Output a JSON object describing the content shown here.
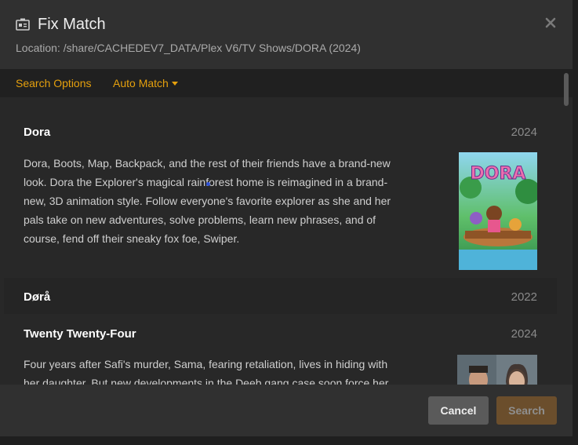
{
  "dialog": {
    "title": "Fix Match",
    "location": "Location: /share/CACHEDEV7_DATA/Plex V6/TV Shows/DORA (2024)",
    "icon": "id-card-icon",
    "close_icon": "close-icon"
  },
  "tabs": {
    "search_options": "Search Options",
    "auto_match": "Auto Match"
  },
  "results": [
    {
      "name": "Dora",
      "year": "2024",
      "summary": "Dora, Boots, Map, Backpack, and the rest of their friends have a brand-new look. Dora the Explorer's magical rainforest home is reimagined in a brand-new, 3D animation style. Follow everyone's favorite explorer as she and her pals take on new adventures, solve problems, learn new phrases, and of course, fend off their sneaky fox foe, Swiper.",
      "poster_text": "DORA"
    },
    {
      "name": "Dørå",
      "year": "2022"
    },
    {
      "name": "Twenty Twenty-Four",
      "year": "2024",
      "summary": "Four years after Safi's murder, Sama, fearing retaliation, lives in hiding with her daughter. But new developments in the Deeb gang case soon force her out of"
    }
  ],
  "footer": {
    "cancel_label": "Cancel",
    "search_label": "Search"
  },
  "colors": {
    "accent": "#e5a00d",
    "background": "#282828",
    "header": "#303030"
  }
}
